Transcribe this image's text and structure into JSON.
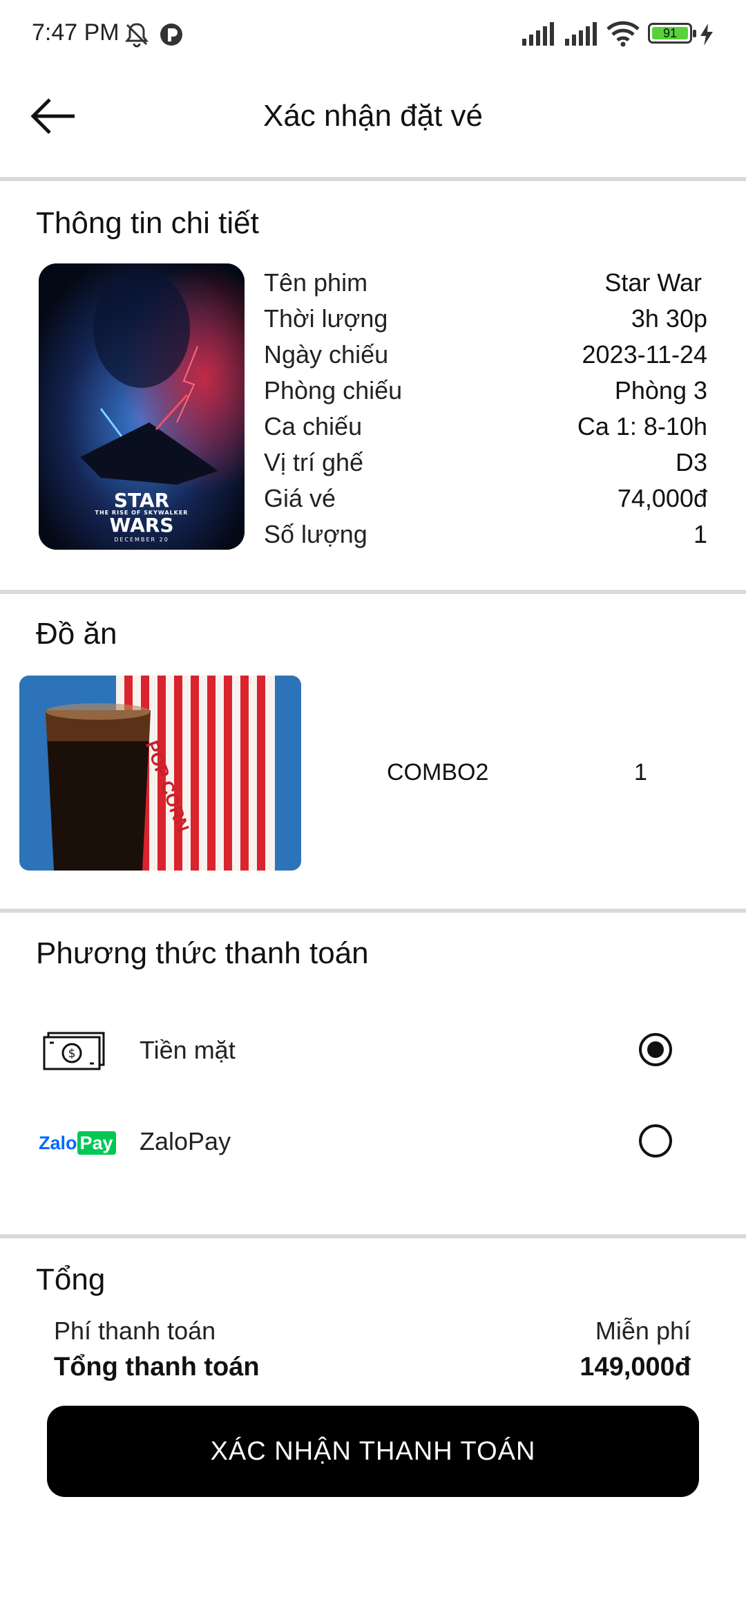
{
  "status_bar": {
    "time": "7:47 PM",
    "battery": "91"
  },
  "header": {
    "title": "Xác nhận đặt vé"
  },
  "details": {
    "section_title": "Thông tin chi tiết",
    "rows": [
      {
        "label": "Tên phim",
        "value": "Star War"
      },
      {
        "label": "Thời lượng",
        "value": "3h 30p"
      },
      {
        "label": "Ngày chiếu",
        "value": "2023-11-24"
      },
      {
        "label": "Phòng chiếu",
        "value": "Phòng 3"
      },
      {
        "label": "Ca chiếu",
        "value": "Ca 1: 8-10h"
      },
      {
        "label": "Vị trí ghế",
        "value": "D3"
      },
      {
        "label": "Giá vé",
        "value": "74,000đ"
      },
      {
        "label": "Số lượng",
        "value": "1"
      }
    ],
    "poster": {
      "logo_top": "STAR",
      "logo_bottom": "WARS",
      "subtitle": "THE RISE OF SKYWALKER",
      "date": "DECEMBER 20"
    }
  },
  "food": {
    "section_title": "Đồ ăn",
    "item_name": "COMBO2",
    "item_qty": "1",
    "popcorn_text": "POP CORN"
  },
  "payment": {
    "section_title": "Phương thức thanh toán",
    "options": [
      {
        "label": "Tiền mặt",
        "icon": "cash-icon",
        "selected": true
      },
      {
        "label": "ZaloPay",
        "icon": "zalopay-logo",
        "logo_text_a": "Zalo",
        "logo_text_b": "Pay",
        "selected": false
      }
    ]
  },
  "total": {
    "section_title": "Tổng",
    "fee_label": "Phí thanh toán",
    "fee_value": "Miễn phí",
    "total_label": "Tổng thanh toán",
    "total_value": "149,000đ"
  },
  "confirm_button": "XÁC NHẬN THANH TOÁN",
  "colors": {
    "divider": "#d9d9d9",
    "button": "#000000",
    "zalo_blue": "#0068ff",
    "zalo_green": "#00c853"
  }
}
